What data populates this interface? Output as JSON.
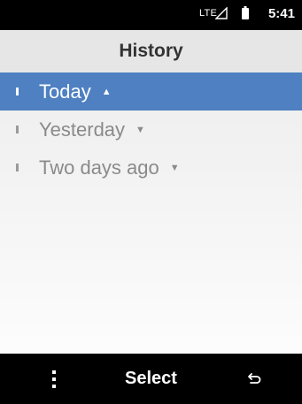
{
  "status_bar": {
    "network": "LTE",
    "time": "5:41",
    "icons": [
      "signal-icon",
      "battery-icon"
    ]
  },
  "header": {
    "title": "History"
  },
  "list": {
    "items": [
      {
        "label": "Today",
        "expanded": true,
        "selected": true
      },
      {
        "label": "Yesterday",
        "expanded": false,
        "selected": false
      },
      {
        "label": "Two days ago",
        "expanded": false,
        "selected": false
      }
    ]
  },
  "softkeys": {
    "left_icon": "options-menu-icon",
    "center_label": "Select",
    "right_icon": "back-icon"
  },
  "colors": {
    "selection": "#4e80c2",
    "header_bg": "#e6e6e6",
    "bars": "#000000"
  }
}
